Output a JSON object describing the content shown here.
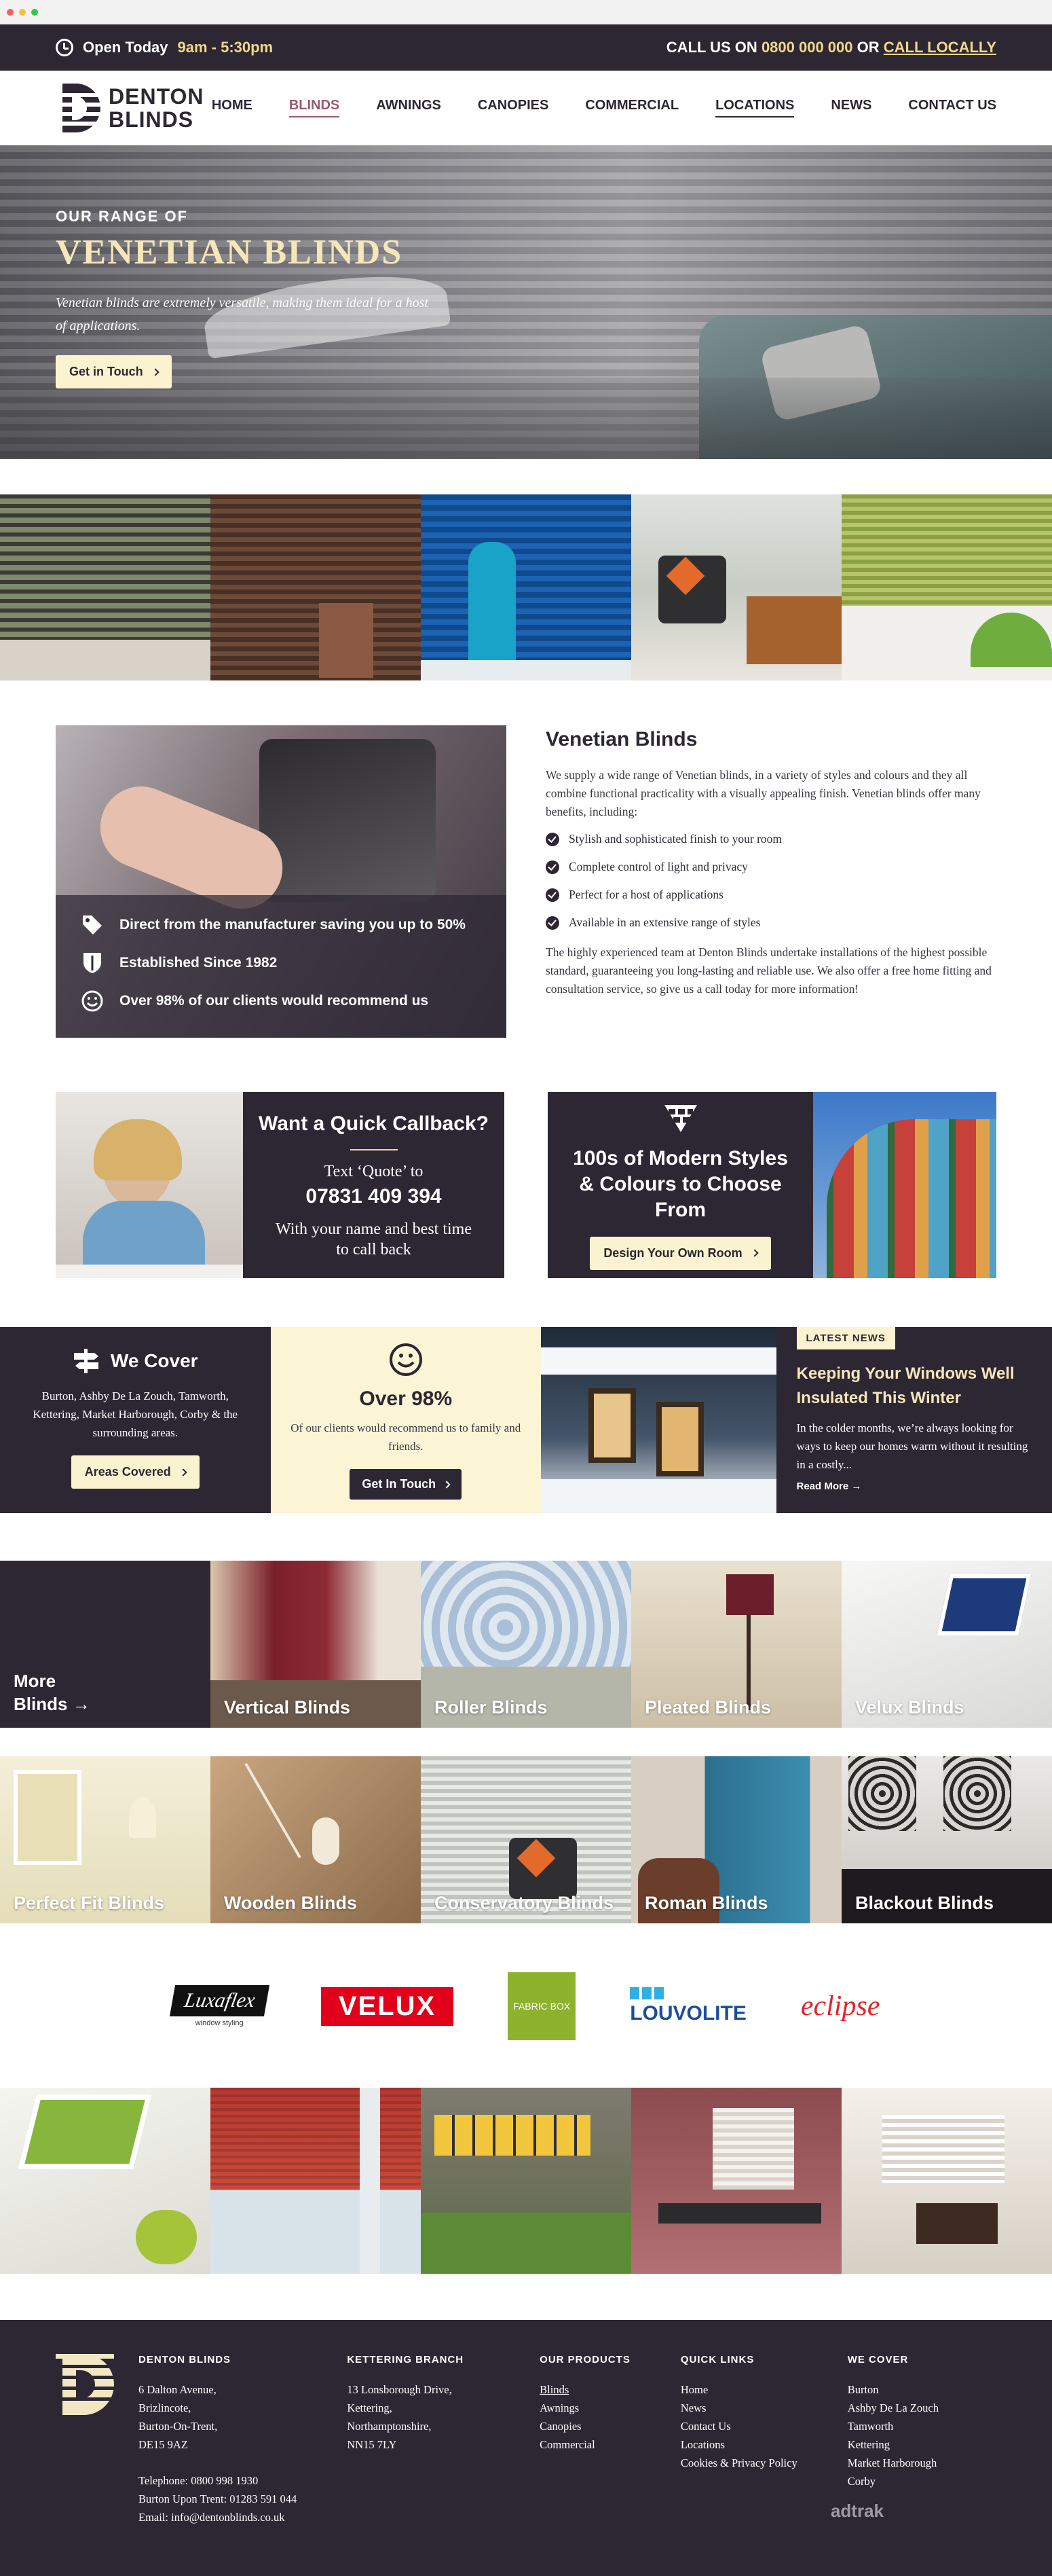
{
  "topbar": {
    "open_label": "Open Today",
    "hours": "9am - 5:30pm",
    "call_prefix": "CALL US ON",
    "phone": "0800 000 000",
    "or_label": "OR",
    "call_locally": "CALL LOCALLY"
  },
  "nav": {
    "logo_line1": "DENTON",
    "logo_line2": "BLINDS",
    "items": [
      "HOME",
      "BLINDS",
      "AWNINGS",
      "CANOPIES",
      "COMMERCIAL",
      "LOCATIONS",
      "NEWS",
      "CONTACT US"
    ],
    "active": "BLINDS"
  },
  "hero": {
    "kicker": "OUR RANGE OF",
    "title": "VENETIAN BLINDS",
    "text": "Venetian blinds are extremely versatile, making them ideal for a host of applications.",
    "button": "Get in Touch"
  },
  "intro": {
    "features": [
      "Direct from the manufacturer saving you up to 50%",
      "Established Since 1982",
      "Over 98% of our clients would recommend us"
    ],
    "heading": "Venetian Blinds",
    "paragraph1": "We supply a wide range of Venetian blinds, in a variety of styles and colours and they all combine functional practicality with a visually appealing finish. Venetian blinds offer many benefits, including:",
    "benefits": [
      "Stylish and sophisticated finish to your room",
      "Complete control of light and privacy",
      "Perfect for a host of applications",
      "Available in an extensive range of styles"
    ],
    "paragraph2": "The highly experienced team at Denton Blinds undertake installations of the highest possible standard, guaranteeing you long-lasting and reliable use. We also offer a free home fitting and consultation service, so give us a call today for more information!"
  },
  "callback": {
    "title": "Want a Quick Callback?",
    "text_line": "Text ‘Quote’ to",
    "number": "07831 409 394",
    "detail": "With your name and best time to call back"
  },
  "styles": {
    "title": "100s of Modern Styles & Colours to Choose From",
    "button": "Design Your Own Room"
  },
  "cover": {
    "title": "We Cover",
    "text": "Burton, Ashby De La Zouch, Tamworth, Kettering, Market Harborough, Corby & the surrounding areas.",
    "button": "Areas Covered"
  },
  "approval": {
    "title": "Over 98%",
    "text": "Of our clients would recommend us to family and friends.",
    "button": "Get In Touch"
  },
  "news": {
    "tag": "LATEST NEWS",
    "title": "Keeping Your Windows Well Insulated This Winter",
    "text": "In the colder months, we’re always looking for ways to keep our homes warm without it resulting in a costly...",
    "more": "Read More"
  },
  "products": {
    "more_line1": "More",
    "more_line2": "Blinds",
    "row1": [
      "Vertical Blinds",
      "Roller Blinds",
      "Pleated Blinds",
      "Velux Blinds"
    ],
    "row2": [
      "Perfect Fit Blinds",
      "Wooden Blinds",
      "Conservatory Blinds",
      "Roman Blinds",
      "Blackout Blinds"
    ]
  },
  "brands": {
    "luxaflex": "Luxaflex",
    "luxaflex_sub": "window styling",
    "velux": "VELUX",
    "fabricbox": "FABRIC BOX",
    "louvolite": "LOUVOLITE",
    "eclipse": "eclipse"
  },
  "footer": {
    "denton_title": "DENTON BLINDS",
    "denton_address": [
      "6 Dalton Avenue,",
      "Brizlincote,",
      "Burton-On-Trent,",
      "DE15 9AZ"
    ],
    "contact": [
      "Telephone: 0800 998 1930",
      "Burton Upon Trent: 01283 591 044",
      "Email: info@dentonblinds.co.uk"
    ],
    "kettering_title": "KETTERING BRANCH",
    "kettering_address": [
      "13 Lonsborough Drive,",
      "Kettering,",
      "Northamptonshire,",
      "NN15 7LY"
    ],
    "products_title": "OUR PRODUCTS",
    "products": [
      "Blinds",
      "Awnings",
      "Canopies",
      "Commercial"
    ],
    "links_title": "QUICK LINKS",
    "links": [
      "Home",
      "News",
      "Contact Us",
      "Locations",
      "Cookies & Privacy Policy"
    ],
    "cover_title": "WE COVER",
    "cover": [
      "Burton",
      "Ashby De La Zouch",
      "Tamworth",
      "Kettering",
      "Market Harborough",
      "Corby"
    ],
    "credit": "adtrak"
  },
  "colors": {
    "primary": "#2c2733",
    "accent": "#f1d98a",
    "cream": "#fbf3cf",
    "active_link": "#9b5a6d"
  }
}
